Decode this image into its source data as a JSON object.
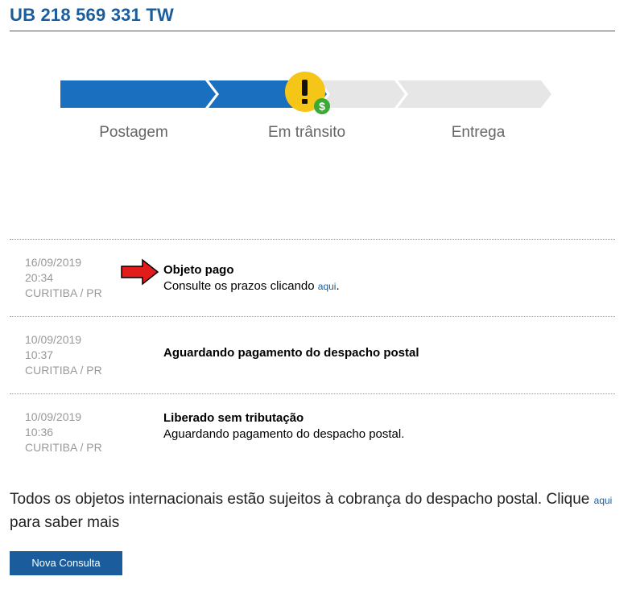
{
  "header": {
    "tracking_code": "UB 218 569 331 TW"
  },
  "progress": {
    "stages": [
      {
        "label": "Postagem",
        "status": "completed"
      },
      {
        "label": "Em trânsito",
        "status": "current"
      },
      {
        "label": "Entrega",
        "status": "pending"
      }
    ],
    "status_icon": "warning-money-icon",
    "colors": {
      "completed": "#1a6fbf",
      "pending": "#e6e6e6",
      "warning": "#f5c518",
      "money": "#3aaa35"
    }
  },
  "events": [
    {
      "date": "16/09/2019",
      "time": "20:34",
      "location": "CURITIBA / PR",
      "title": "Objeto pago",
      "desc_before": "Consulte os prazos clicando ",
      "desc_link": "aqui",
      "desc_after": ".",
      "marker": "red-arrow-icon"
    },
    {
      "date": "10/09/2019",
      "time": "10:37",
      "location": "CURITIBA / PR",
      "title": "Aguardando pagamento do despacho postal"
    },
    {
      "date": "10/09/2019",
      "time": "10:36",
      "location": "CURITIBA / PR",
      "title": "Liberado sem tributação",
      "desc": "Aguardando pagamento do despacho postal."
    }
  ],
  "notice": {
    "text_before": "Todos os objetos internacionais estão sujeitos à cobrança do despacho postal. Clique ",
    "link": "aqui",
    "text_after": " para saber mais"
  },
  "buttons": {
    "new_query": "Nova Consulta"
  }
}
